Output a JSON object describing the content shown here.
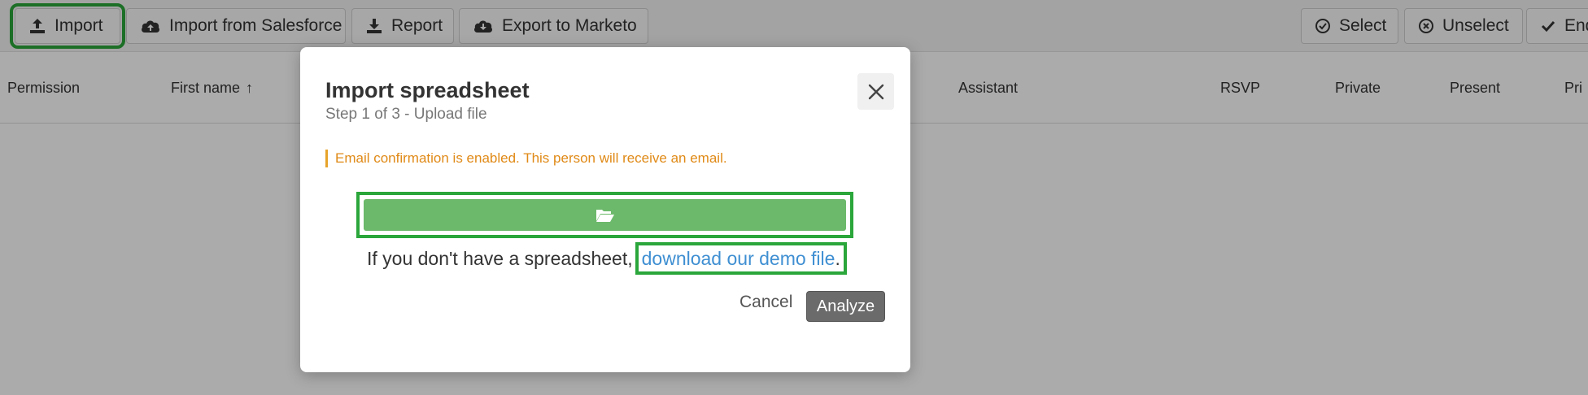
{
  "toolbar": {
    "import_label": "Import",
    "import_salesforce_label": "Import from Salesforce",
    "report_label": "Report",
    "export_marketo_label": "Export to Marketo",
    "select_label": "Select",
    "unselect_label": "Unselect",
    "end_label": "End"
  },
  "columns": {
    "permission": "Permission",
    "first_name": "First name",
    "first_name_sort": "↑",
    "assistant": "Assistant",
    "rsvp": "RSVP",
    "private": "Private",
    "present": "Present",
    "partial": "Pri"
  },
  "modal": {
    "title": "Import spreadsheet",
    "subtitle": "Step 1 of 3 - Upload file",
    "warning": "Email confirmation is enabled. This person will receive an email.",
    "upload_icon": "folder-open-icon",
    "demo_text": "If you don't have a spreadsheet,",
    "demo_link": "download our demo file",
    "demo_period": ".",
    "cancel_label": "Cancel",
    "analyze_label": "Analyze"
  },
  "colors": {
    "highlight": "#2aa63a",
    "upload_button": "#6cb96b",
    "warning_text": "#e08a17",
    "link": "#3f8fd2",
    "analyze_button": "#6b6b6b"
  }
}
